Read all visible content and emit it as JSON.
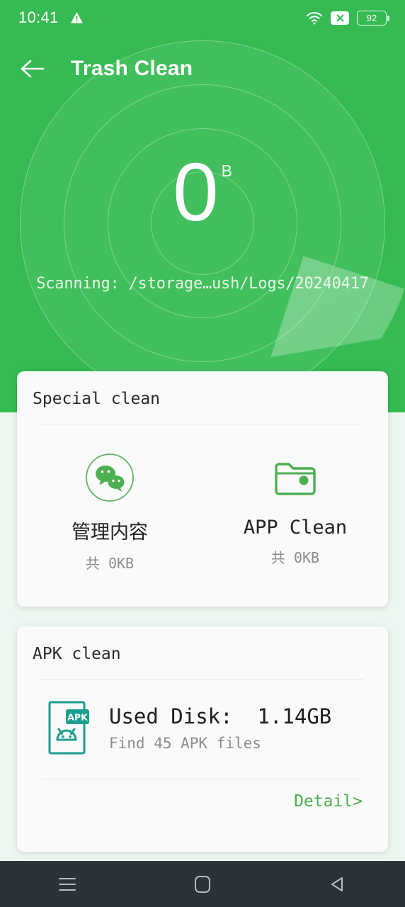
{
  "status_bar": {
    "time": "10:41",
    "warning_icon": "warning-triangle-icon",
    "wifi_icon": "wifi-icon",
    "signal_x_icon": "signal-x-icon",
    "battery_level": "92"
  },
  "app_bar": {
    "back_icon": "back-arrow-icon",
    "title": "Trash Clean"
  },
  "scanner": {
    "amount": "0",
    "unit": "B",
    "status_text": "Scanning: /storage…ush/Logs/20240417",
    "accent_color": "#35bb52"
  },
  "special_clean": {
    "title": "Special clean",
    "items": [
      {
        "icon": "wechat-icon",
        "label": "管理内容",
        "size": "共 0KB"
      },
      {
        "icon": "folder-icon",
        "label": "APP Clean",
        "size": "共 0KB"
      }
    ]
  },
  "apk_clean": {
    "title": "APK clean",
    "icon": "apk-file-icon",
    "icon_badge": "APK",
    "used_disk": "Used Disk:  1.14GB",
    "found_files": "Find 45 APK files",
    "detail_label": "Detail>",
    "detail_color": "#4caf50"
  },
  "nav_bar": {
    "recents_icon": "menu-recents-icon",
    "home_icon": "home-square-icon",
    "back_icon": "back-triangle-icon"
  }
}
